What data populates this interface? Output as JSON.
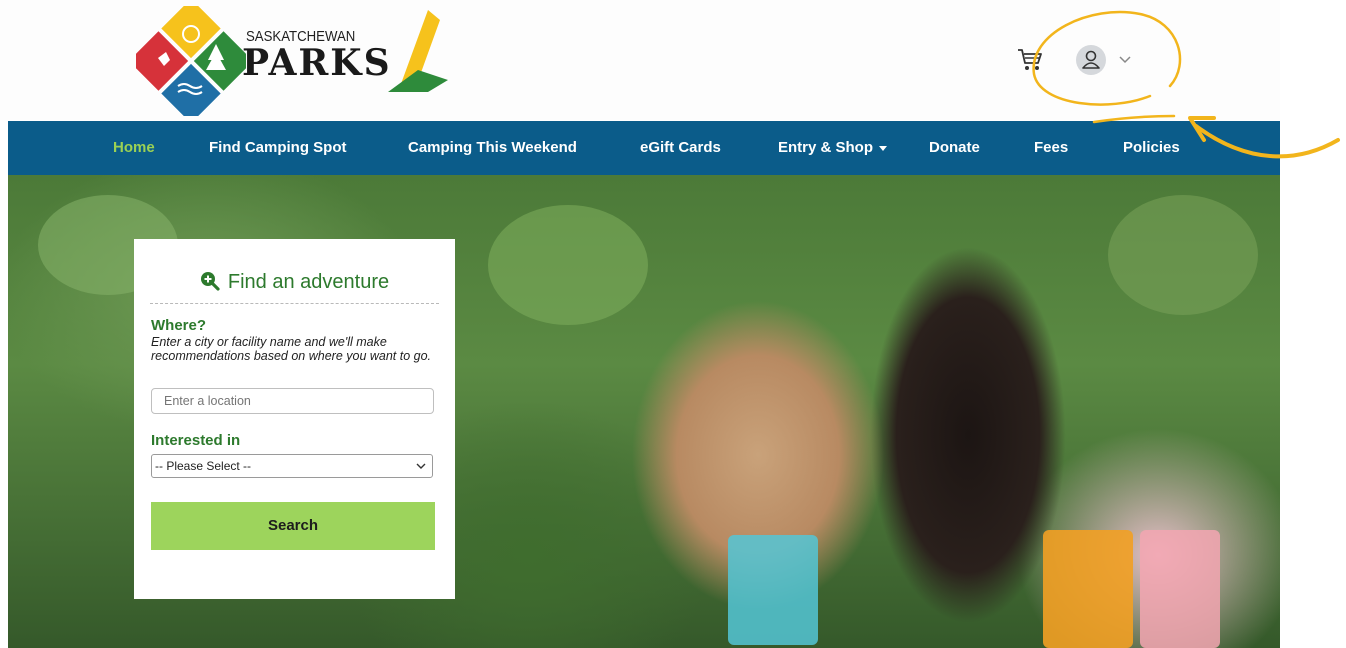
{
  "brand": {
    "subtitle": "SASKATCHEWAN",
    "title": "PARKS"
  },
  "header": {
    "cart_icon": "cart-icon",
    "user_icon": "user-icon"
  },
  "nav": {
    "items": [
      {
        "label": "Home",
        "active": true
      },
      {
        "label": "Find Camping Spot"
      },
      {
        "label": "Camping This Weekend"
      },
      {
        "label": "eGift Cards"
      },
      {
        "label": "Entry & Shop"
      },
      {
        "label": "Donate"
      },
      {
        "label": "Fees"
      },
      {
        "label": "Policies"
      }
    ]
  },
  "search": {
    "title": "Find an adventure",
    "where_label": "Where?",
    "where_help": "Enter a city or facility name and we'll make recommendations based on where you want to go.",
    "location_placeholder": "Enter a location",
    "interest_label": "Interested in",
    "interest_selected": "-- Please Select --",
    "button": "Search"
  },
  "colors": {
    "nav_bg": "#0b5c8a",
    "nav_active": "#9bd154",
    "accent_green": "#2d7a2d",
    "button_green": "#9dd45c",
    "annotation": "#f2b51c"
  }
}
